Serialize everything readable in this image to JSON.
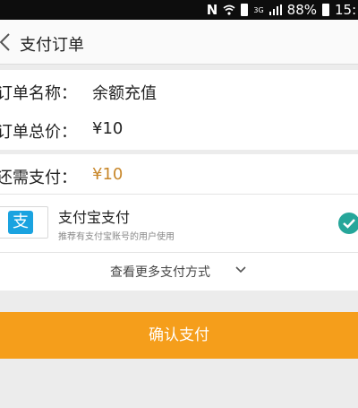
{
  "status_bar": {
    "network_letter": "N",
    "network_type": "3G",
    "battery": "88%",
    "time": "15:"
  },
  "header": {
    "title": "支付订单"
  },
  "order": {
    "name_label": "订单名称：",
    "name_value": "余额充值",
    "total_label": "订单总价：",
    "total_value": "¥10"
  },
  "payment": {
    "due_label": "还需支付：",
    "due_value": "¥10",
    "method_icon_text": "支",
    "method_name": "支付宝支付",
    "method_desc": "推荐有支付宝账号的用户使用",
    "more_label": "查看更多支付方式"
  },
  "confirm_button": "确认支付",
  "colors": {
    "accent": "#f59e1b",
    "check": "#26a69a",
    "alipay_blue": "#1aa3e0",
    "price_highlight": "#c8872a"
  }
}
